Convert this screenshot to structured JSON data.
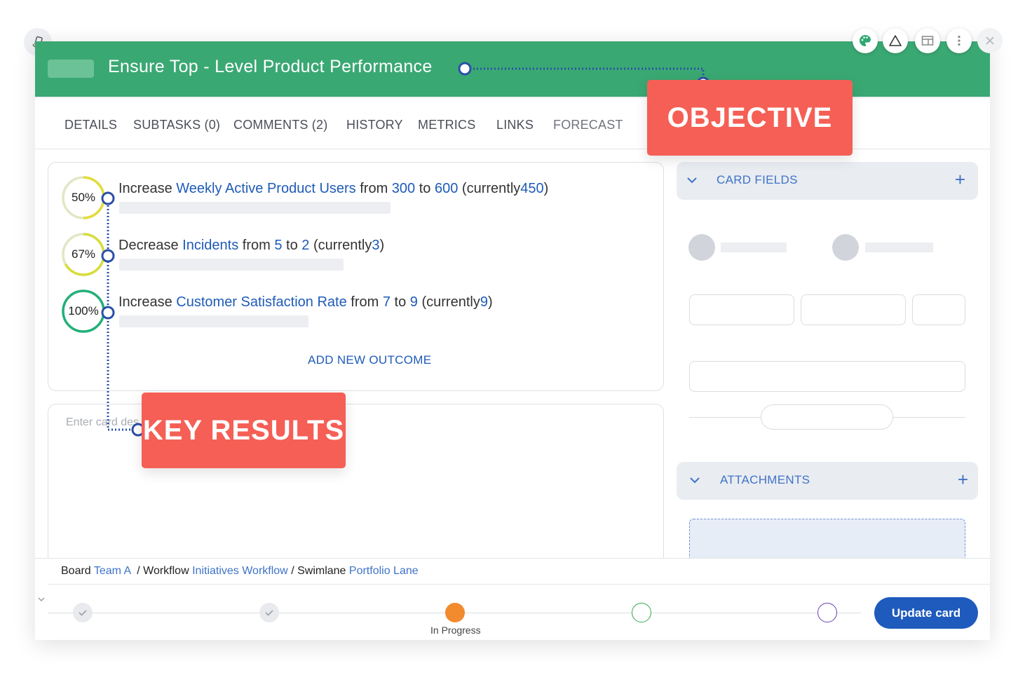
{
  "card": {
    "title": "Ensure Top - Level Product Performance"
  },
  "tabs": [
    {
      "label": "DETAILS"
    },
    {
      "label": "SUBTASKS (0)"
    },
    {
      "label": "COMMENTS (2)"
    },
    {
      "label": "HISTORY"
    },
    {
      "label": "METRICS"
    },
    {
      "label": "LINKS"
    },
    {
      "label": "FORECAST"
    }
  ],
  "key_results": [
    {
      "percent": "50%",
      "progress": 0.5,
      "ring_color": "#e3dc3b",
      "verb": "Increase",
      "metric": "Weekly Active Product Users",
      "from_word": "from",
      "from": "300",
      "to_word": "to",
      "to": "600",
      "currently_word": "(currently",
      "current": "450",
      "close": ")"
    },
    {
      "percent": "67%",
      "progress": 0.67,
      "ring_color": "#d7dd3a",
      "verb": "Decrease",
      "metric": "Incidents",
      "from_word": "from",
      "from": "5",
      "to_word": "to",
      "to": "2",
      "currently_word": "(currently",
      "current": "3",
      "close": ")"
    },
    {
      "percent": "100%",
      "progress": 1.0,
      "ring_color": "#22b07a",
      "verb": "Increase",
      "metric": "Customer Satisfaction Rate",
      "from_word": "from",
      "from": "7",
      "to_word": "to",
      "to": "9",
      "currently_word": "(currently",
      "current": "9",
      "close": ")"
    }
  ],
  "add_outcome_label": "ADD NEW OUTCOME",
  "description": {
    "placeholder": "Enter card des"
  },
  "sidebar": {
    "card_fields_label": "CARD FIELDS",
    "attachments_label": "ATTACHMENTS",
    "plus": "+"
  },
  "breadcrumb": {
    "board_label": "Board",
    "board_value": "Team A",
    "sep1": "/",
    "workflow_label": "Workflow",
    "workflow_value": "Initiatives Workflow",
    "sep2": "/",
    "swimlane_label": "Swimlane",
    "swimlane_value": "Portfolio Lane"
  },
  "workflow_steps": {
    "current_label": "In Progress",
    "colors": {
      "done": "#e8eaed",
      "current": "#f28a2e",
      "next": "#34a853",
      "later": "#6b3fb8"
    }
  },
  "update_button_label": "Update card",
  "annotations": {
    "objective": "OBJECTIVE",
    "key_results": "KEY RESULTS"
  },
  "icons": {
    "corner": "rotate-device-icon",
    "palette": "palette-icon",
    "triangle": "warning-triangle-icon",
    "layout": "layout-icon",
    "more": "more-vertical-icon",
    "close": "close-icon"
  },
  "colors": {
    "header_green": "#3aa873",
    "link_blue": "#1e5bb8",
    "callout_red": "#f55f55",
    "connector_blue": "#2a4fa8"
  }
}
